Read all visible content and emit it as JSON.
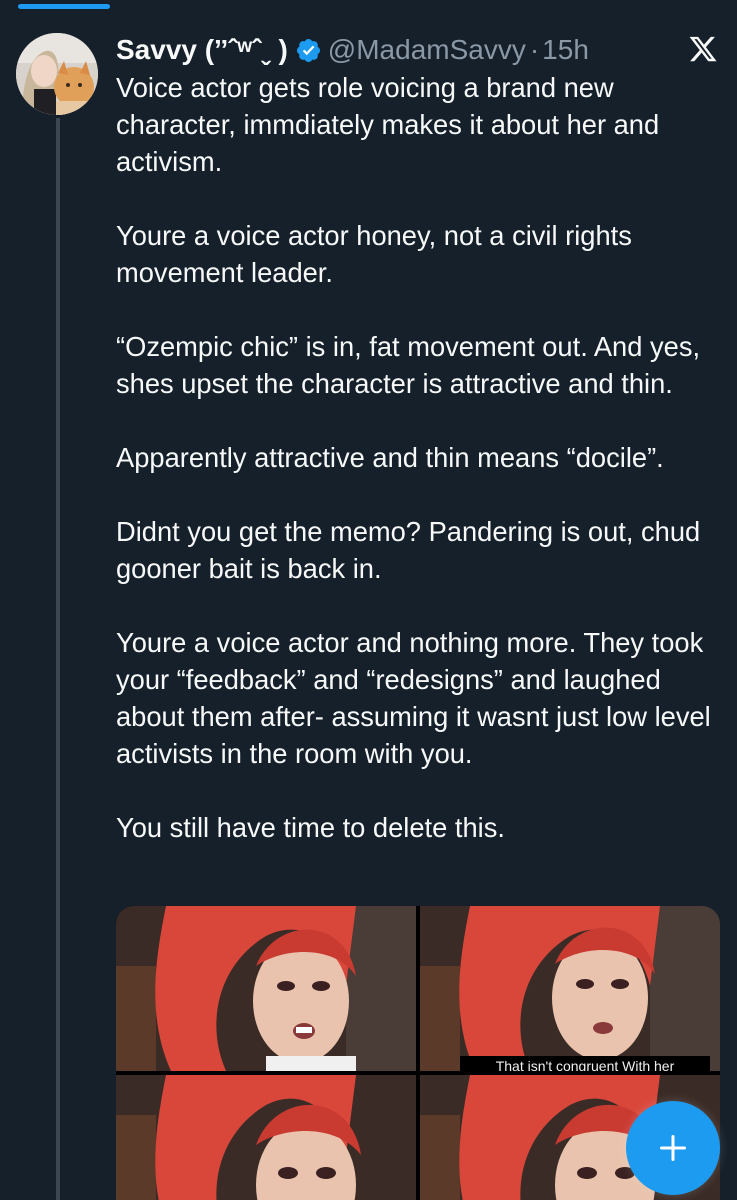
{
  "tweet": {
    "display_name": "Savvy (ˮˆʷˆˬ )",
    "handle": "@MadamSavvy",
    "separator": "·",
    "timestamp": "15h",
    "paragraphs": [
      "Voice actor gets role voicing a brand new character, immdiately makes it about her and activism.",
      "Youre a voice actor honey, not a civil rights movement leader.",
      "“Ozempic chic” is in, fat movement out. And yes, shes upset the character is attractive and thin.",
      "Apparently attractive and thin means “docile”.",
      "Didnt you get the memo? Pandering is out, chud gooner bait is back in.",
      "Youre a voice actor and nothing more. They took your “feedback” and “redesigns” and laughed about them after- assuming it wasnt just low level activists in the room with you.",
      "You still have time to delete this."
    ],
    "media": {
      "caption": "That isn't congruent With her"
    }
  },
  "icons": {
    "verified": "verified-badge-icon",
    "x_logo": "x-logo-icon",
    "compose": "plus-icon"
  },
  "colors": {
    "background": "#15202b",
    "accent": "#1d9bf0",
    "text_primary": "#f7f9f9",
    "text_secondary": "#8b98a5"
  }
}
